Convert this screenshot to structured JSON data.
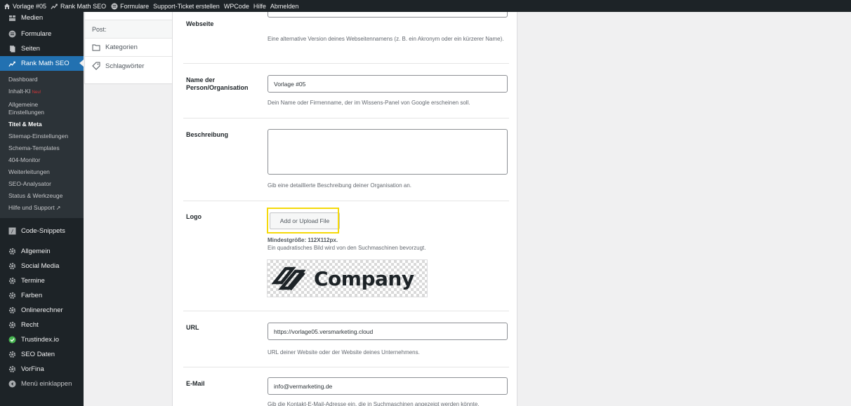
{
  "adminbar": {
    "site": "Vorlage #05",
    "rankmath": "Rank Math SEO",
    "formulare": "Formulare",
    "support": "Support-Ticket erstellen",
    "wpcode": "WPCode",
    "hilfe": "Hilfe",
    "abmelden": "Abmelden"
  },
  "sidebar": {
    "medien": "Medien",
    "formulare": "Formulare",
    "seiten": "Seiten",
    "rankmath": "Rank Math SEO",
    "sub": {
      "dashboard": "Dashboard",
      "inhalt_ki": "Inhalt-KI",
      "new_badge": "Neu!",
      "allgemeine": "Allgemeine Einstellungen",
      "titel_meta": "Titel & Meta",
      "sitemap": "Sitemap-Einstellungen",
      "schema": "Schema-Templates",
      "monitor": "404-Monitor",
      "weiterleitungen": "Weiterleitungen",
      "analysator": "SEO-Analysator",
      "status": "Status & Werkzeuge",
      "hilfe": "Hilfe und Support"
    },
    "code_snippets": "Code-Snippets",
    "allgemein": "Allgemein",
    "social_media": "Social Media",
    "termine": "Termine",
    "farben": "Farben",
    "onlinerechner": "Onlinerechner",
    "recht": "Recht",
    "trustindex": "Trustindex.io",
    "seo_daten": "SEO Daten",
    "vorfina": "VorFina",
    "collapse": "Menü einklappen"
  },
  "left_panel": {
    "post": "Post:",
    "kategorien": "Kategorien",
    "schlagwoerter": "Schlagwörter"
  },
  "form": {
    "webseite_label": "Webseite",
    "webseite_desc": "Eine alternative Version deines Webseitennamens (z. B. ein Akronym oder ein kürzerer Name).",
    "name_label": "Name der Person/Organisation",
    "name_value": "Vorlage #05",
    "name_desc": "Dein Name oder Firmenname, der im Wissens-Panel von Google erscheinen soll.",
    "beschreibung_label": "Beschreibung",
    "beschreibung_desc": "Gib eine detaillierte Beschreibung deiner Organisation an.",
    "logo_label": "Logo",
    "upload_button": "Add or Upload File",
    "logo_min": "Mindestgröße: 112X112px.",
    "logo_desc": "Ein quadratisches Bild wird von den Suchmaschinen bevorzugt.",
    "logo_text": "Company",
    "url_label": "URL",
    "url_value": "https://vorlage05.versmarketing.cloud",
    "url_desc": "URL deiner Website oder der Website deines Unternehmens.",
    "email_label": "E-Mail",
    "email_value": "info@vermarketing.de",
    "email_desc": "Gib die Kontakt-E-Mail-Adresse ein, die in Suchmaschinen angezeigt werden könnte."
  },
  "colors": {
    "active": "#2271b1",
    "highlight": "#f5d90a",
    "trust": "#46b450"
  }
}
